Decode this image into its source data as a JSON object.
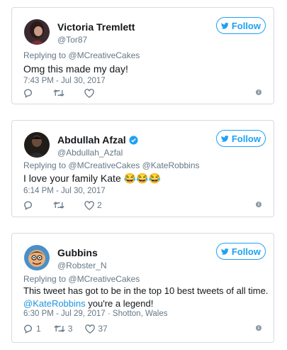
{
  "colors": {
    "accent": "#1da1f2",
    "link": "#1b95e0",
    "muted": "#657786",
    "border": "#d7dadd"
  },
  "follow_label": "Follow",
  "tweets": [
    {
      "name": "Victoria Tremlett",
      "handle": "@Tor87",
      "verified": false,
      "replying_prefix": "Replying to",
      "replying_to": "@MCreativeCakes",
      "text": "Omg this made my day!",
      "timestamp": "7:43 PM - Jul 30, 2017",
      "replies": "",
      "retweets": "",
      "likes": ""
    },
    {
      "name": "Abdullah Afzal",
      "handle": "@Abdullah_Azfal",
      "verified": true,
      "replying_prefix": "Replying to",
      "replying_to": "@MCreativeCakes @KateRobbins",
      "text": "I love your family Kate 😂😂😂",
      "timestamp": "6:14 PM - Jul 30, 2017",
      "replies": "",
      "retweets": "",
      "likes": "2"
    },
    {
      "name": "Gubbins",
      "handle": "@Robster_N",
      "verified": false,
      "replying_prefix": "Replying to",
      "replying_to": "@MCreativeCakes",
      "text_line1": "This tweet has got to be in the top 10 best tweets of all time.",
      "text_mention": "@KateRobbins",
      "text_line2_rest": " you're a legend!",
      "timestamp": "6:30 PM - Jul 29, 2017 · Shotton, Wales",
      "replies": "1",
      "retweets": "3",
      "likes": "37"
    }
  ]
}
